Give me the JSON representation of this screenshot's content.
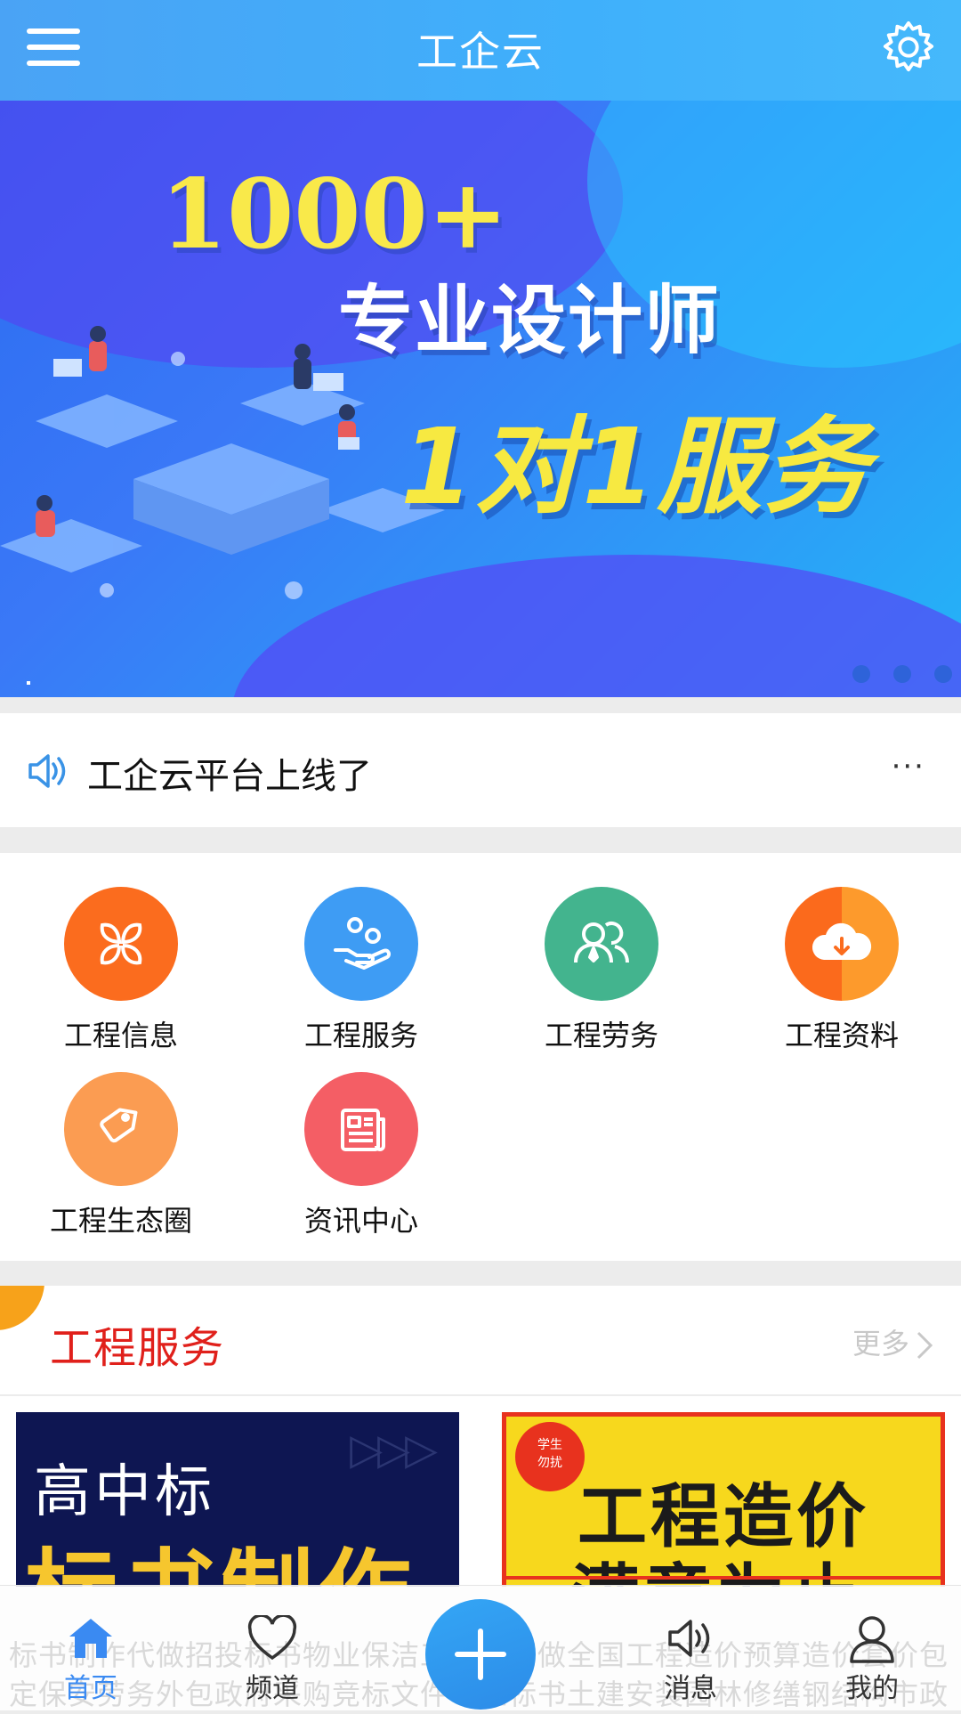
{
  "header": {
    "title": "工企云"
  },
  "banner": {
    "stat": "1000+",
    "line2": "专业设计师",
    "line3": "1对1服务"
  },
  "notice": {
    "text": "工企云平台上线了",
    "more": "···"
  },
  "grid": [
    {
      "label": "工程信息",
      "color": "#fb6c1e",
      "icon": "four-leaf-icon"
    },
    {
      "label": "工程服务",
      "color": "#3e9cf4",
      "icon": "hand-service-icon"
    },
    {
      "label": "工程劳务",
      "color": "#43b48e",
      "icon": "people-icon"
    },
    {
      "label": "工程资料",
      "color": "#fd7d1e",
      "icon": "cloud-download-icon"
    },
    {
      "label": "工程生态圈",
      "color": "#fb9c52",
      "icon": "tag-icon"
    },
    {
      "label": "资讯中心",
      "color": "#f45e65",
      "icon": "newspaper-icon"
    }
  ],
  "section": {
    "title": "工程服务",
    "more": "更多"
  },
  "cards": {
    "card1": {
      "line1": "高中标",
      "line2": "标书制作"
    },
    "card2": {
      "badge": "学生\n勿扰",
      "line1": "工程造价",
      "line2": "满意为止"
    }
  },
  "marquee": "标书制作代做招投标书物业保洁工程预算做全国工程造价预算造价套价包定保安劳务外包政府采购竞标文件专业标书土建安装园林修缮钢结构市政",
  "tabbar": {
    "home": "首页",
    "channel": "频道",
    "message": "消息",
    "mine": "我的"
  },
  "colors": {
    "accent": "#3a8af2",
    "header": "#42aaf8",
    "section_title": "#e0201b"
  }
}
